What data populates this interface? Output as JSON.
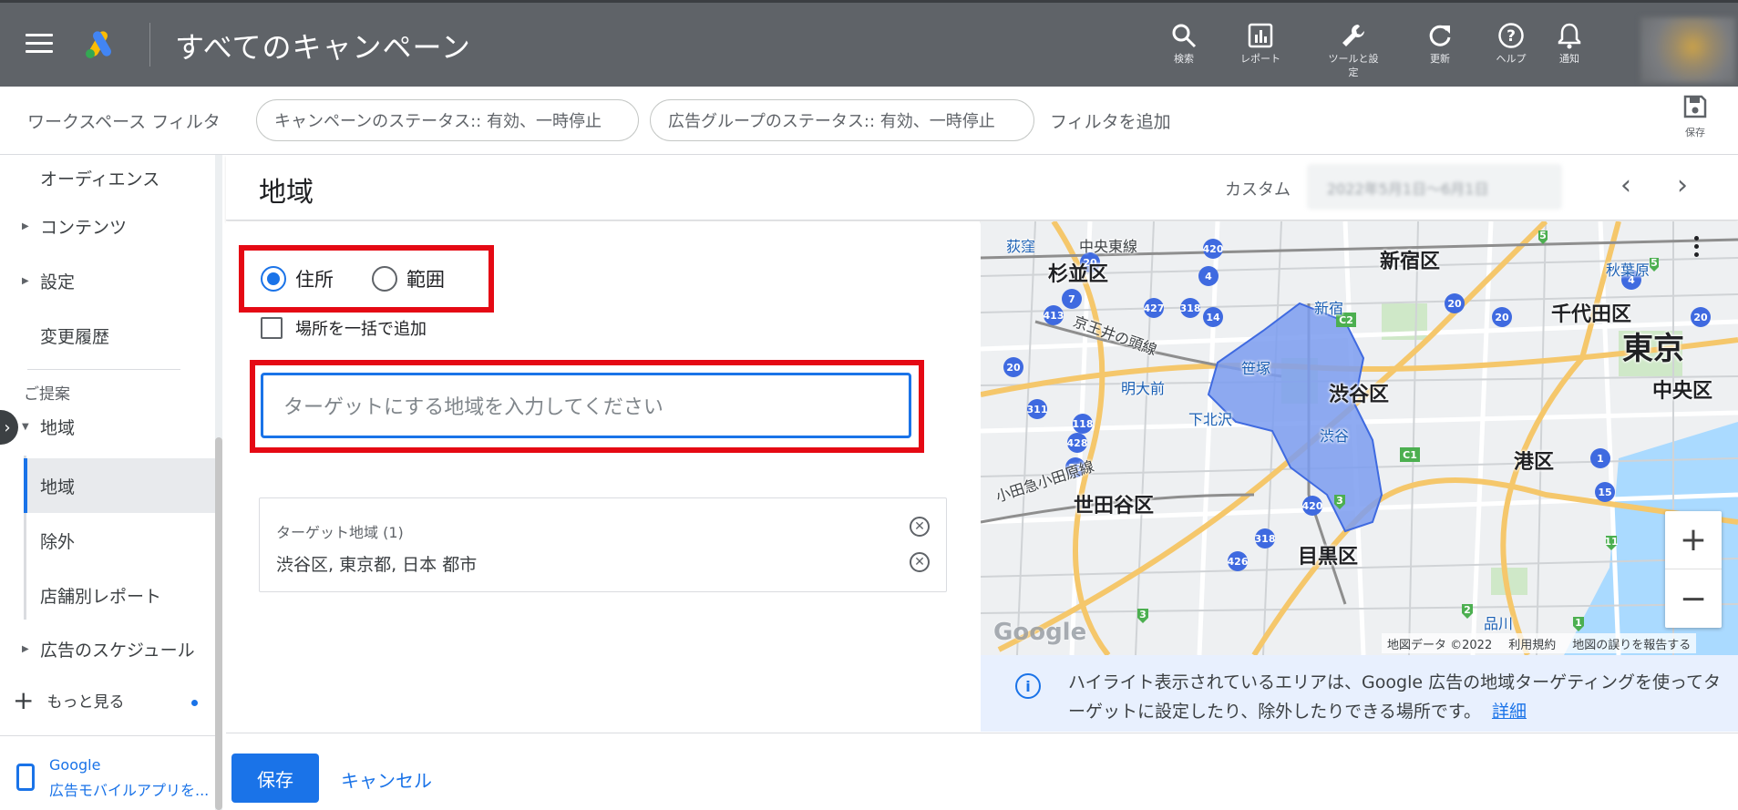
{
  "header": {
    "title": "すべてのキャンペーン",
    "tools": [
      {
        "icon": "search-icon",
        "label": "検索"
      },
      {
        "icon": "report-icon",
        "label": "レポート"
      },
      {
        "icon": "wrench-icon",
        "label": "ツールと設定"
      },
      {
        "icon": "refresh-icon",
        "label": "更新"
      },
      {
        "icon": "help-icon",
        "label": "ヘルプ"
      },
      {
        "icon": "bell-icon",
        "label": "通知"
      }
    ]
  },
  "filters": {
    "label": "ワークスペース フィルタ",
    "chips": [
      "キャンペーンのステータス:: 有効、一時停止",
      "広告グループのステータス:: 有効、一時停止"
    ],
    "add_label": "フィルタを追加",
    "save_label": "保存"
  },
  "sidebar": {
    "items": [
      "オーディエンス",
      "コンテンツ",
      "設定",
      "変更履歴"
    ],
    "section_heading": "ご提案",
    "group_label": "地域",
    "sub_items": [
      "地域",
      "除外",
      "店舗別レポート"
    ],
    "schedule_label": "広告のスケジュール",
    "more_label": "もっと見る",
    "app_line1": "Google",
    "app_line2": "広告モバイルアプリを..."
  },
  "main": {
    "title": "地域",
    "custom_label": "カスタム",
    "date_range": "2022年5月1日〜6月1日",
    "radio_address": "住所",
    "radio_radius": "範囲",
    "radio_selected": "住所",
    "bulk_add_label": "場所を一括で追加",
    "search_placeholder": "ターゲットにする地域を入力してください",
    "target_title": "ターゲット地域 (1)",
    "target_value": "渋谷区, 東京都, 日本 都市"
  },
  "map": {
    "wards": [
      "杉並区",
      "新宿区",
      "千代田区",
      "東京",
      "中央区",
      "渋谷区",
      "港区",
      "世田谷区",
      "目黒区"
    ],
    "places": [
      "荻窪",
      "中央東線",
      "秋葉原",
      "京王井の頭線",
      "明大前",
      "下北沢",
      "小田急小田原線",
      "新宿",
      "笹塚",
      "渋谷",
      "品川"
    ],
    "attribution": [
      "地図データ ©2022",
      "利用規約",
      "地図の誤りを報告する"
    ],
    "google_mark": "Google",
    "highlight_color": "#7b9cf0"
  },
  "info": {
    "text": "ハイライト表示されているエリアは、Google 広告の地域ターゲティングを使ってターゲットに設定したり、除外したりできる場所です。",
    "link": "詳細"
  },
  "footer": {
    "save_label": "保存",
    "cancel_label": "キャンセル"
  },
  "colors": {
    "topbar": "#5f6368",
    "accent": "#1a73e8",
    "annotation_red": "#e50914"
  }
}
